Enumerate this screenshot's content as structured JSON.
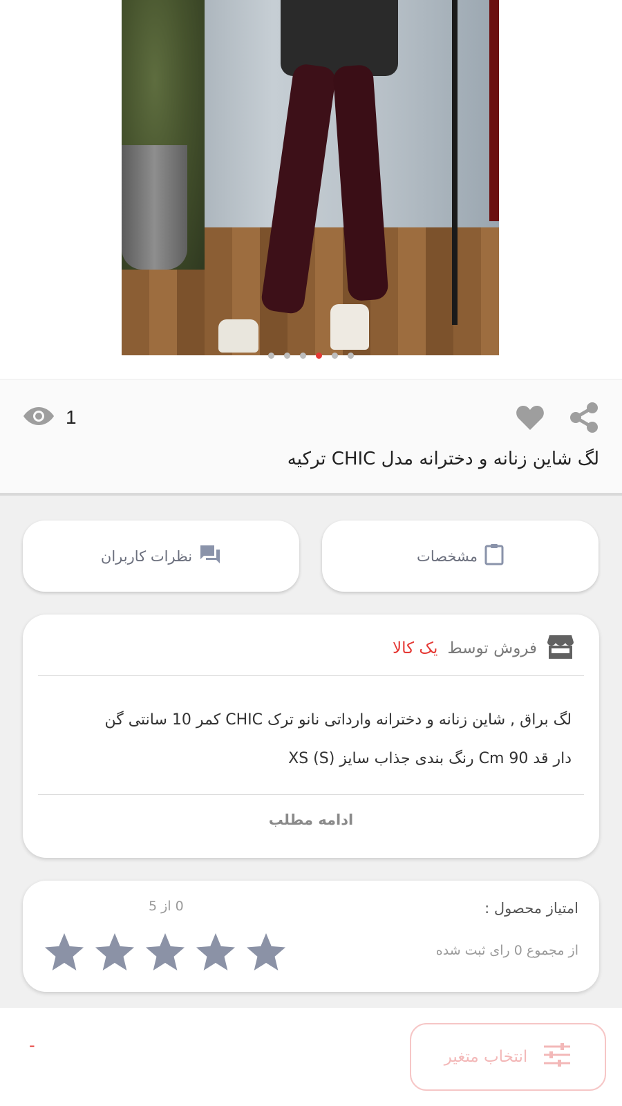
{
  "gallery": {
    "dots": [
      false,
      false,
      false,
      true,
      false,
      false
    ]
  },
  "info": {
    "views_count": "1",
    "title": "لگ شاین زنانه و دخترانه مدل CHIC ترکیه"
  },
  "tabs": {
    "specs_label": "مشخصات",
    "reviews_label": "نظرات کاربران"
  },
  "card": {
    "seller_prefix": "فروش توسط",
    "seller_name": "یک کالا",
    "description_line1": "لگ براق , شاین زنانه و دخترانه وارداتی نانو ترک CHIC کمر 10 سانتی گن",
    "description_line2": "دار قد 90 Cm رنگ بندی جذاب سایز (S)  XS",
    "read_more": "ادامه مطلب"
  },
  "rating": {
    "label": "امتیاز محصول :",
    "score_text": "0 از 5",
    "total_text": "از مجموع 0 رای ثبت شده",
    "stars": 5,
    "star_color": "#8b92a6"
  },
  "bottom": {
    "variant_button": "انتخاب متغیر",
    "price": "-"
  },
  "colors": {
    "accent": "#e53935",
    "icon_gray": "#9e9e9e",
    "tab_icon": "#8a93aa"
  }
}
